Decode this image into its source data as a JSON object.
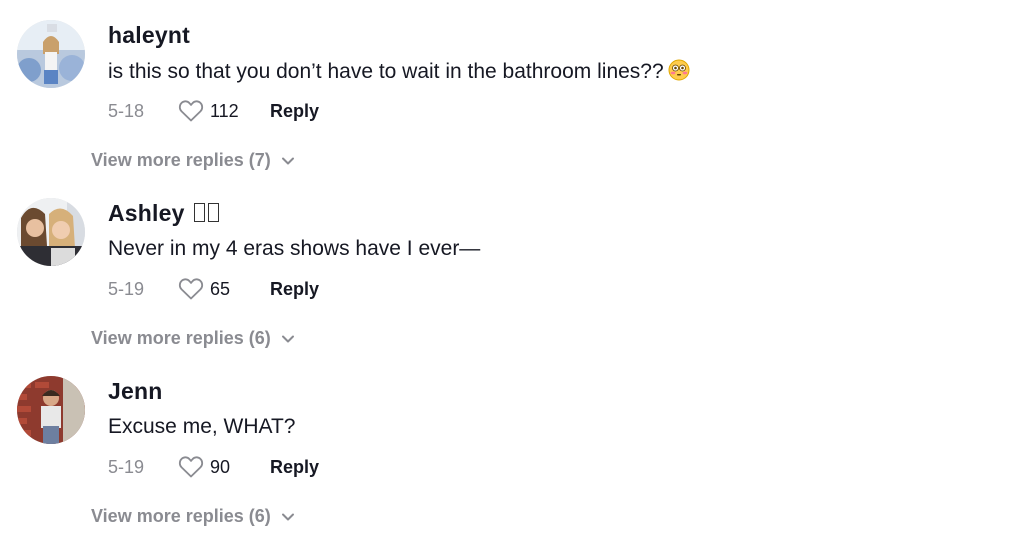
{
  "comments": [
    {
      "username": "haleynt",
      "text": "is this so that you don’t have to wait in the bathroom lines??",
      "date": "5-18",
      "likes": "112",
      "reply_label": "Reply",
      "more_replies": "View more replies (7)",
      "trailing_emoji": "flushed-face-emoji"
    },
    {
      "username": "Ashley",
      "text": "Never in my 4 eras shows have I ever—",
      "date": "5-19",
      "likes": "65",
      "reply_label": "Reply",
      "more_replies": "View more replies (6)"
    },
    {
      "username": "Jenn",
      "text": "Excuse me, WHAT?",
      "date": "5-19",
      "likes": "90",
      "reply_label": "Reply",
      "more_replies": "View more replies (6)"
    }
  ],
  "icons": {
    "like": "heart-outline-icon",
    "expand": "chevron-down-icon"
  },
  "colors": {
    "text": "#161823",
    "muted": "#8a8b91"
  }
}
